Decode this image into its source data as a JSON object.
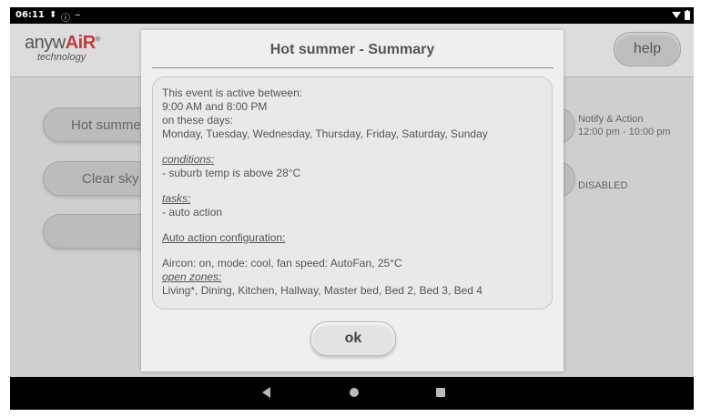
{
  "status_bar": {
    "time": "06:11",
    "left_icons": [
      "usb-icon",
      "info-icon",
      "charging-icon"
    ],
    "right_icons": [
      "wifi-icon",
      "battery-icon"
    ]
  },
  "app": {
    "logo": {
      "brand_prefix": "anyw",
      "brand_accent": "AiR",
      "trademark": "®",
      "tagline": "technology"
    },
    "help_label": "help",
    "events": [
      {
        "label": "Hot summe"
      },
      {
        "label": "Clear sky"
      }
    ],
    "add_button_glyph": "+",
    "side_info": {
      "line1": "Notify & Action",
      "line2": "12:00 pm - 10:00 pm",
      "line3": "DISABLED"
    }
  },
  "dialog": {
    "title": "Hot summer - Summary",
    "active_intro": "This event is active between:",
    "time_range": "9:00 AM and 8:00 PM",
    "days_intro": "on these days:",
    "days": "Monday, Tuesday, Wednesday, Thursday, Friday, Saturday, Sunday",
    "conditions_heading": "conditions:",
    "condition": "- suburb temp is above 28°C",
    "tasks_heading": "tasks:",
    "task": "- auto action",
    "auto_config_heading": "Auto action configuration:",
    "aircon": "Aircon: on, mode: cool, fan speed: AutoFan, 25°C",
    "zones_heading": "open zones:",
    "zones": "Living*, Dining, Kitchen, Hallway, Master bed, Bed 2, Bed 3, Bed 4",
    "ok_label": "ok"
  },
  "nav_bar": {
    "buttons": [
      "back-icon",
      "home-icon",
      "recents-icon"
    ]
  },
  "colors": {
    "accent_red": "#c63a3a",
    "background": "#cfcfcf",
    "dialog": "#efefef"
  }
}
